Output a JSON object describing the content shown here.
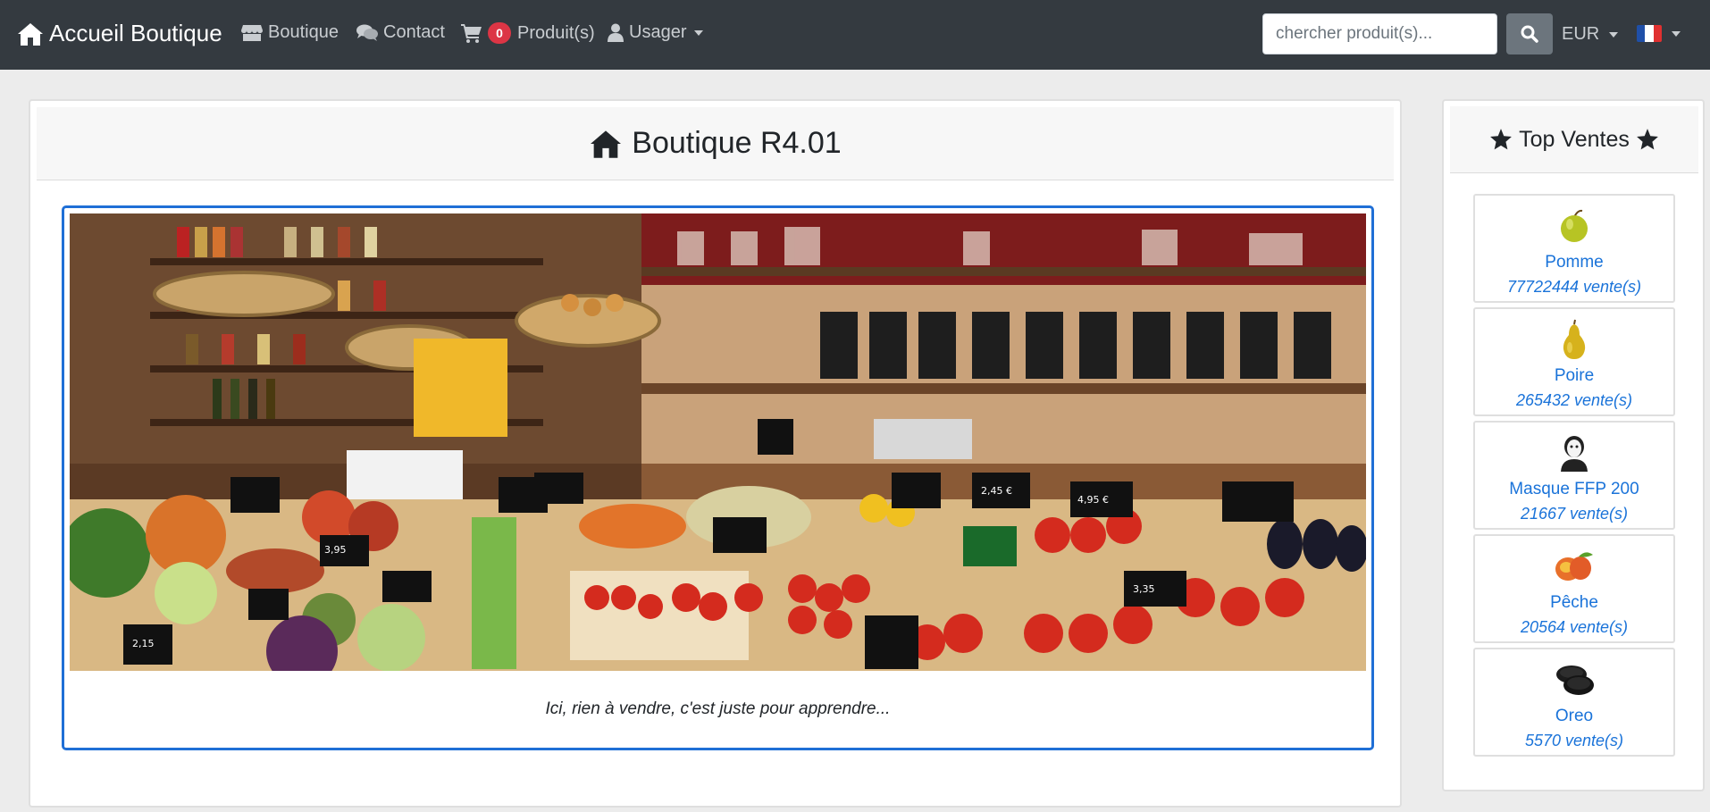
{
  "navbar": {
    "brand": "Accueil Boutique",
    "boutique": "Boutique",
    "contact": "Contact",
    "cart_count": "0",
    "cart_label": "Produit(s)",
    "user": "Usager",
    "search_placeholder": "chercher produit(s)...",
    "currency": "EUR",
    "language_flag": "fr-flag-icon"
  },
  "main": {
    "title": "Boutique R4.01",
    "caption": "Ici, rien à vendre, c'est juste pour apprendre..."
  },
  "top_sales": {
    "title": "Top Ventes",
    "products": [
      {
        "name": "Pomme",
        "sales": "77722444 vente(s)",
        "icon": "apple-icon"
      },
      {
        "name": "Poire",
        "sales": "265432 vente(s)",
        "icon": "pear-icon"
      },
      {
        "name": "Masque FFP 200",
        "sales": "21667 vente(s)",
        "icon": "mask-icon"
      },
      {
        "name": "Pêche",
        "sales": "20564 vente(s)",
        "icon": "peach-icon"
      },
      {
        "name": "Oreo",
        "sales": "5570 vente(s)",
        "icon": "cookie-icon"
      }
    ]
  },
  "colors": {
    "navbar": "#343a40",
    "accent": "#1f6fd6",
    "link": "#1a73d9",
    "badge": "#dc3545"
  }
}
